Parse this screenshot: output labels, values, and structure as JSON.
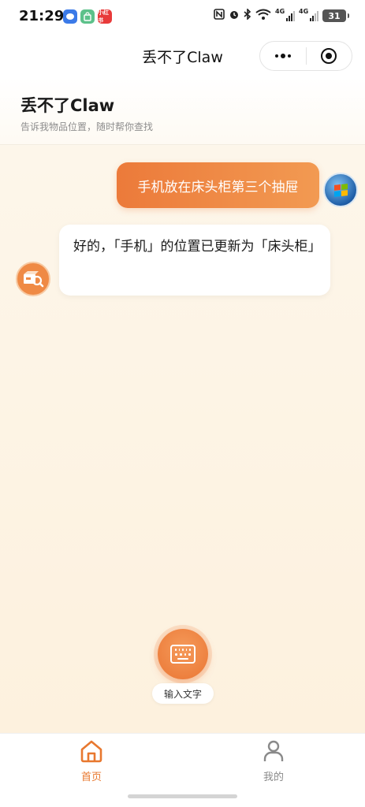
{
  "status_bar": {
    "time": "21:29",
    "app_badges": [
      {
        "icon": "message-app-icon",
        "color": "#3b7ae8",
        "text": ""
      },
      {
        "icon": "shopping-bag-app-icon",
        "color": "#5cc18a",
        "text": ""
      },
      {
        "icon": "red-app-icon",
        "color": "#e83a3a",
        "text": "小红书"
      }
    ],
    "network_type_1": "4G",
    "network_type_2": "4G",
    "wifi_label": "6",
    "battery": "31"
  },
  "nav": {
    "title": "丢不了Claw"
  },
  "header": {
    "title": "丢不了Claw",
    "subtitle": "告诉我物品位置，随时帮你查找"
  },
  "chat": {
    "messages": [
      {
        "role": "user",
        "text": "手机放在床头柜第三个抽屉"
      },
      {
        "role": "bot",
        "text": "好的，「手机」的位置已更新为「床头柜」"
      }
    ]
  },
  "input": {
    "label": "输入文字"
  },
  "tabs": [
    {
      "label": "首页",
      "icon": "home-icon",
      "active": true
    },
    {
      "label": "我的",
      "icon": "user-icon",
      "active": false
    }
  ],
  "colors": {
    "accent": "#ec7a3a",
    "background": "#fdf6ea",
    "tab_inactive": "#8a8a8a"
  }
}
